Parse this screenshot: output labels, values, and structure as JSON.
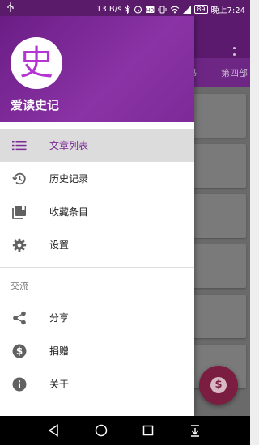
{
  "status_bar": {
    "left_icon": "usb-icon",
    "speed": "13 B/s",
    "battery": "89",
    "time": "晚上7:24",
    "icons": [
      "bluetooth-icon",
      "alarm-icon",
      "hd-icon",
      "vibrate-icon",
      "wifi-icon",
      "signal-icon",
      "battery-icon"
    ]
  },
  "drawer": {
    "avatar_char": "史",
    "app_name": "爱读史记",
    "items": [
      {
        "label": "文章列表",
        "icon": "list-icon",
        "active": true
      },
      {
        "label": "历史记录",
        "icon": "history-icon",
        "active": false
      },
      {
        "label": "收藏条目",
        "icon": "collection-icon",
        "active": false
      },
      {
        "label": "设置",
        "icon": "gear-icon",
        "active": false
      }
    ],
    "section_title": "交流",
    "section_items": [
      {
        "label": "分享",
        "icon": "share-icon"
      },
      {
        "label": "捐赠",
        "icon": "dollar-icon"
      },
      {
        "label": "关于",
        "icon": "info-icon"
      }
    ]
  },
  "background": {
    "tabs": [
      "书",
      "第四部"
    ],
    "fab_icon": "dollar-icon"
  },
  "nav_bar": {
    "buttons": [
      "back-icon",
      "home-icon",
      "recents-icon",
      "notification-pull-icon"
    ]
  },
  "colors": {
    "primary_dark": "#5a1b6a",
    "primary": "#7b2a96",
    "active_row": "#dcdcdc",
    "icon": "#616161"
  }
}
